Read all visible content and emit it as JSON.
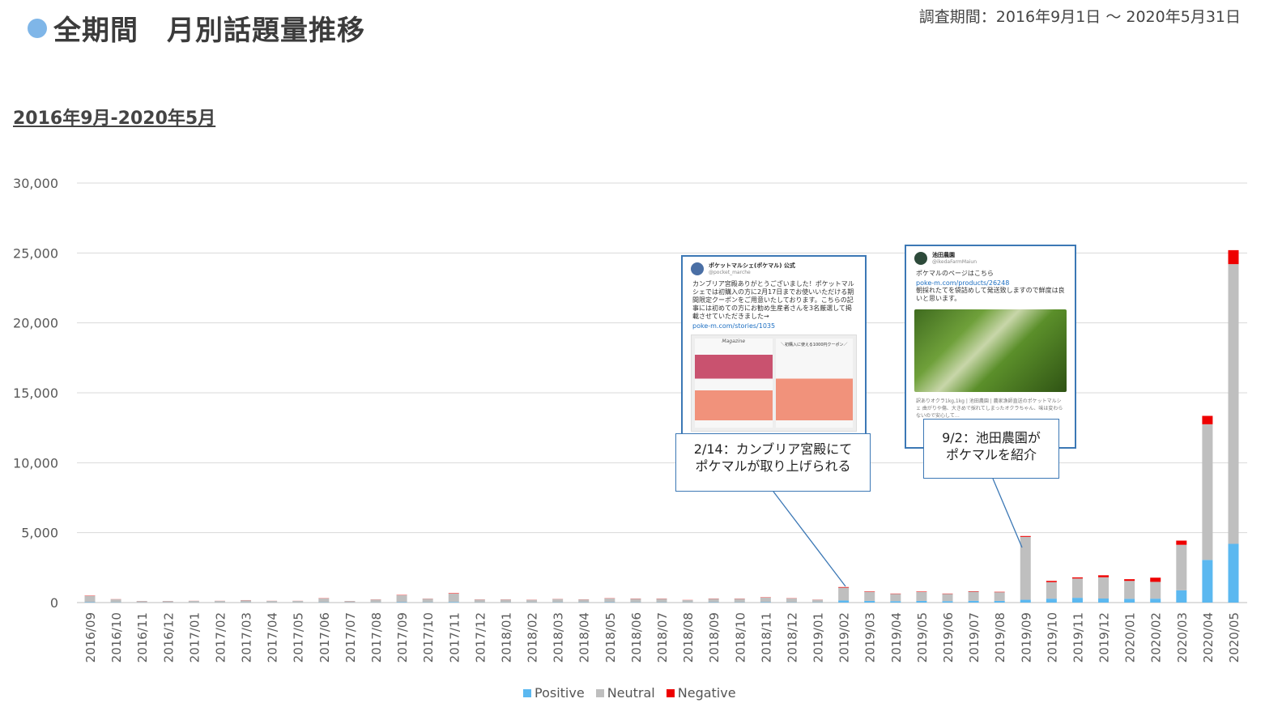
{
  "header": {
    "title": "全期間　月別話題量推移",
    "period": "調査期間：2016年9月1日 ～ 2020年5月31日",
    "subtitle": "2016年9月-2020年5月"
  },
  "colors": {
    "positive": "#5bb8f0",
    "neutral": "#bfbfbf",
    "negative": "#ee0000",
    "title_dot": "#7fb6e8",
    "annotation_border": "#3c78b5"
  },
  "tweets": {
    "t1": {
      "name": "ポケットマルシェ(ポケマル) 公式",
      "handle": "@pocket_marche",
      "body": "カンブリア宮殿ありがとうございました！ポケットマルシェでは初購入の方に2月17日までお使いいただける期間限定クーポンをご用意いたしております。こちらの記事には初めての方にお勧め生産者さんを3名厳選して掲載させていただきました→",
      "link": "poke-m.com/stories/1035",
      "card_left_label": "Magazine",
      "card_right_label": "＼初購入に使える1000円クーポン／"
    },
    "t2": {
      "name": "池田農園",
      "handle": "@ikedaFarmMaiun",
      "body1": "ポケマルのページはこちら",
      "link": "poke-m.com/products/26248",
      "body2": "朝採れたてを袋詰めして発送致しますので鮮度は良いと思います。",
      "footer": "訳ありオクラ1kg,1kg | 池田農園 | 農家漁師直送のポケットマルシェ 曲がりや傷、大きめで採れてしまったオクラちゃん、味は変わらないので安心して…"
    }
  },
  "callouts": {
    "c1": {
      "line1": "2/14：カンブリア宮殿にて",
      "line2": "ポケマルが取り上げられる"
    },
    "c2": {
      "line1": "9/2：池田農園が",
      "line2": "ポケマルを紹介"
    }
  },
  "legend": {
    "positive": "Positive",
    "neutral": "Neutral",
    "negative": "Negative"
  },
  "chart_data": {
    "type": "bar",
    "stacked": true,
    "ylim": [
      0,
      30000
    ],
    "yticks": [
      0,
      5000,
      10000,
      15000,
      20000,
      25000,
      30000
    ],
    "ytick_labels": [
      "0",
      "5,000",
      "10,000",
      "15,000",
      "20,000",
      "25,000",
      "30,000"
    ],
    "grid": true,
    "legend_position": "bottom",
    "categories": [
      "2016/09",
      "2016/10",
      "2016/11",
      "2016/12",
      "2017/01",
      "2017/02",
      "2017/03",
      "2017/04",
      "2017/05",
      "2017/06",
      "2017/07",
      "2017/08",
      "2017/09",
      "2017/10",
      "2017/11",
      "2017/12",
      "2018/01",
      "2018/02",
      "2018/03",
      "2018/04",
      "2018/05",
      "2018/06",
      "2018/07",
      "2018/08",
      "2018/09",
      "2018/10",
      "2018/11",
      "2018/12",
      "2019/01",
      "2019/02",
      "2019/03",
      "2019/04",
      "2019/05",
      "2019/06",
      "2019/07",
      "2019/08",
      "2019/09",
      "2019/10",
      "2019/11",
      "2019/12",
      "2020/01",
      "2020/02",
      "2020/03",
      "2020/04",
      "2020/05"
    ],
    "series": [
      {
        "name": "Positive",
        "values": [
          30,
          20,
          10,
          10,
          10,
          10,
          15,
          10,
          10,
          20,
          10,
          15,
          30,
          20,
          40,
          15,
          15,
          15,
          20,
          20,
          25,
          20,
          20,
          15,
          25,
          20,
          30,
          20,
          20,
          150,
          120,
          100,
          120,
          100,
          130,
          120,
          200,
          280,
          340,
          290,
          270,
          280,
          880,
          3050,
          4200
        ]
      },
      {
        "name": "Neutral",
        "values": [
          450,
          210,
          100,
          100,
          110,
          110,
          150,
          110,
          110,
          280,
          100,
          200,
          500,
          250,
          600,
          200,
          200,
          180,
          230,
          200,
          270,
          250,
          250,
          160,
          250,
          250,
          330,
          280,
          180,
          920,
          650,
          520,
          640,
          520,
          650,
          620,
          4500,
          1180,
          1380,
          1520,
          1280,
          1200,
          3250,
          9700,
          20000
        ]
      },
      {
        "name": "Negative",
        "values": [
          20,
          10,
          5,
          5,
          5,
          5,
          10,
          5,
          5,
          15,
          5,
          10,
          20,
          10,
          30,
          10,
          10,
          10,
          10,
          10,
          15,
          15,
          15,
          10,
          15,
          15,
          20,
          15,
          10,
          40,
          30,
          25,
          30,
          25,
          30,
          30,
          60,
          90,
          80,
          140,
          120,
          300,
          300,
          600,
          1000
        ]
      }
    ]
  }
}
